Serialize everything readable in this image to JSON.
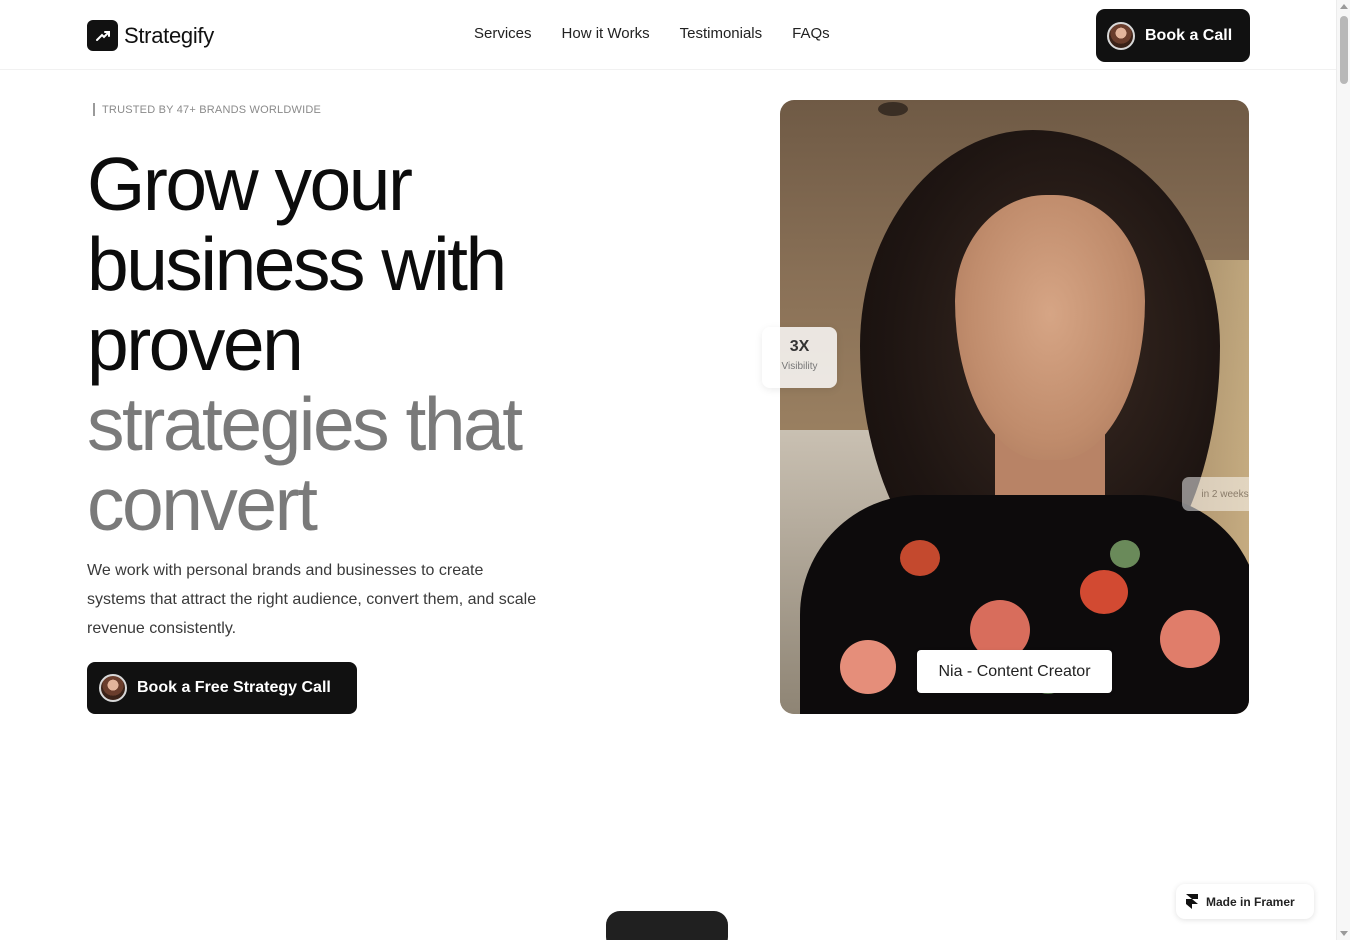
{
  "brand": {
    "name": "Strategify"
  },
  "nav": {
    "items": [
      {
        "label": "Services"
      },
      {
        "label": "How it Works"
      },
      {
        "label": "Testimonials"
      },
      {
        "label": "FAQs"
      }
    ],
    "cta_label": "Book a Call"
  },
  "hero": {
    "eyebrow": "TRUSTED BY 47+ BRANDS WORLDWIDE",
    "headline": {
      "line1": "Grow your",
      "line2": "business with",
      "line3": "proven",
      "line4": "strategies that",
      "line5": "convert"
    },
    "subcopy": "We work with personal brands and businesses to create systems that attract the right audience, convert them, and scale revenue consistently.",
    "cta_label": "Book a Free Strategy Call"
  },
  "photo_card": {
    "stat_value": "3X",
    "stat_label": "Visibility",
    "side_note": "in 2 weeks",
    "caption": "Nia - Content Creator"
  },
  "footer_badge": {
    "label": "Made in Framer"
  },
  "colors": {
    "primary": "#111111",
    "muted_text": "#7a7a7a",
    "background": "#ffffff"
  },
  "icons": {
    "brand": "trend-arrow-icon",
    "framer": "framer-logo-icon"
  }
}
